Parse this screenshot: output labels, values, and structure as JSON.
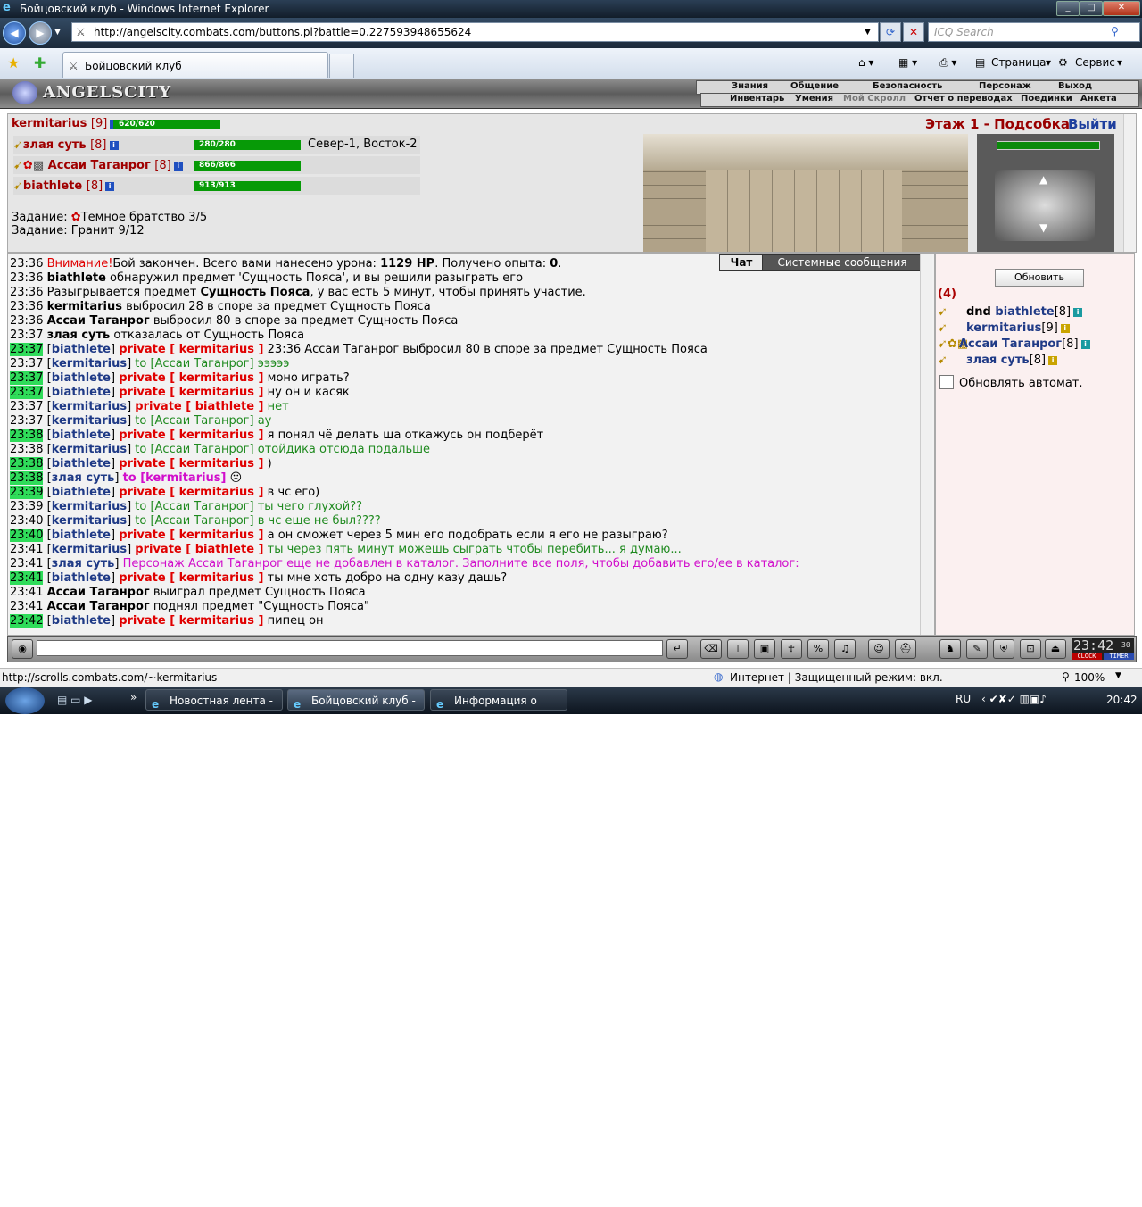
{
  "window": {
    "title": "Бойцовский клуб - Windows Internet Explorer",
    "btn_min": "_",
    "btn_max": "□",
    "btn_close": "✕"
  },
  "browser": {
    "url": "http://angelscity.combats.com/buttons.pl?battle=0.227593948655624",
    "search_placeholder": "ICQ Search",
    "tab_title": "Бойцовский клуб",
    "tool_page": "Страница",
    "tool_service": "Сервис",
    "status_url": "http://scrolls.combats.com/~kermitarius",
    "status_zone": "Интернет | Защищенный режим: вкл.",
    "zoom": "100%"
  },
  "game": {
    "logo": "ANGELSCITY",
    "menu_top": [
      "Знания",
      "Общение",
      "Безопасность",
      "Персонаж",
      "Выход"
    ],
    "menu_bottom": [
      "Инвентарь",
      "Умения",
      "Мой Скролл",
      "Отчет о переводах",
      "Поединки",
      "Анкета"
    ],
    "self": {
      "name": "kermitarius",
      "level": "[9]",
      "hp": "620/620",
      "hp_fraction": 1.0
    },
    "party": [
      {
        "name": "злая суть",
        "level": "[8]",
        "hp": "280/280",
        "hp_fraction": 1.0
      },
      {
        "name": "Ассаи Таганрог",
        "level": "[8]",
        "hp": "866/866",
        "hp_fraction": 1.0
      },
      {
        "name": "biathlete",
        "level": "[8]",
        "hp": "913/913",
        "hp_fraction": 1.0
      }
    ],
    "coords": "Север-1, Восток-2",
    "quest1_label": "Задание:",
    "quest1": "Темное братство 3/5",
    "quest2": "Задание: Гранит 9/12",
    "floor": "Этаж 1 - Подсобка",
    "exit": "Выйти"
  },
  "chat": {
    "tab_chat": "Чат",
    "tab_system": "Системные сообщения",
    "lines": [
      {
        "t": "23:36",
        "parts": [
          [
            "red",
            "Внимание!"
          ],
          [
            "",
            "Бой закончен. Всего вами нанесено урона: "
          ],
          [
            "b",
            "1129 HP"
          ],
          [
            "",
            ". Получено опыта: "
          ],
          [
            "b",
            "0"
          ],
          [
            "",
            "."
          ]
        ]
      },
      {
        "t": "23:36",
        "parts": [
          [
            "b",
            "biathlete"
          ],
          [
            "",
            " обнаружил предмет 'Сущность Пояса', и вы решили разыграть его"
          ]
        ]
      },
      {
        "t": "23:36",
        "parts": [
          [
            "",
            "Разыгрывается предмет "
          ],
          [
            "b",
            "Сущность Пояса"
          ],
          [
            "",
            ", у вас есть 5 минут, чтобы принять участие."
          ]
        ]
      },
      {
        "t": "23:36",
        "parts": [
          [
            "b",
            "kermitarius"
          ],
          [
            "",
            " выбросил 28 в споре за предмет Сущность Пояса"
          ]
        ]
      },
      {
        "t": "23:36",
        "parts": [
          [
            "b",
            "Ассаи Таганрог"
          ],
          [
            "",
            " выбросил 80 в споре за предмет Сущность Пояса"
          ]
        ]
      },
      {
        "t": "23:37",
        "parts": [
          [
            "b",
            "злая суть"
          ],
          [
            "",
            " отказалась от Сущность Пояса"
          ]
        ]
      },
      {
        "t": "23:37",
        "hl": true,
        "parts": [
          [
            "",
            "["
          ],
          [
            "nick",
            "biathlete"
          ],
          [
            "",
            "] "
          ],
          [
            "priv",
            "private [ kermitarius ]"
          ],
          [
            "",
            " 23:36 Ассаи Таганрог выбросил 80 в споре за предмет Сущность Пояса"
          ]
        ]
      },
      {
        "t": "23:37",
        "parts": [
          [
            "",
            "["
          ],
          [
            "nick",
            "kermitarius"
          ],
          [
            "",
            "] "
          ],
          [
            "grn",
            "to [Ассаи Таганрог] эээээ"
          ]
        ]
      },
      {
        "t": "23:37",
        "hl": true,
        "parts": [
          [
            "",
            "["
          ],
          [
            "nick",
            "biathlete"
          ],
          [
            "",
            "] "
          ],
          [
            "priv",
            "private [ kermitarius ]"
          ],
          [
            "",
            " моно играть?"
          ]
        ]
      },
      {
        "t": "23:37",
        "hl": true,
        "parts": [
          [
            "",
            "["
          ],
          [
            "nick",
            "biathlete"
          ],
          [
            "",
            "] "
          ],
          [
            "priv",
            "private [ kermitarius ]"
          ],
          [
            "",
            " ну он и касяк"
          ]
        ]
      },
      {
        "t": "23:37",
        "parts": [
          [
            "",
            "["
          ],
          [
            "nick",
            "kermitarius"
          ],
          [
            "",
            "] "
          ],
          [
            "priv",
            "private [ biathlete ]"
          ],
          [
            "grn",
            " нет"
          ]
        ]
      },
      {
        "t": "23:37",
        "parts": [
          [
            "",
            "["
          ],
          [
            "nick",
            "kermitarius"
          ],
          [
            "",
            "] "
          ],
          [
            "grn",
            "to [Ассаи Таганрог] ау"
          ]
        ]
      },
      {
        "t": "23:38",
        "hl": true,
        "parts": [
          [
            "",
            "["
          ],
          [
            "nick",
            "biathlete"
          ],
          [
            "",
            "] "
          ],
          [
            "priv",
            "private [ kermitarius ]"
          ],
          [
            "",
            " я понял чё делать ща откажусь он подберёт"
          ]
        ]
      },
      {
        "t": "23:38",
        "parts": [
          [
            "",
            "["
          ],
          [
            "nick",
            "kermitarius"
          ],
          [
            "",
            "] "
          ],
          [
            "grn",
            "to [Ассаи Таганрог] отойдика отсюда подальше"
          ]
        ]
      },
      {
        "t": "23:38",
        "hl": true,
        "parts": [
          [
            "",
            "["
          ],
          [
            "nick",
            "biathlete"
          ],
          [
            "",
            "] "
          ],
          [
            "priv",
            "private [ kermitarius ]"
          ],
          [
            "",
            " )"
          ]
        ]
      },
      {
        "t": "23:38",
        "hl": true,
        "parts": [
          [
            "",
            "["
          ],
          [
            "nick",
            "злая суть"
          ],
          [
            "",
            "] "
          ],
          [
            "toP",
            "to [kermitarius]"
          ],
          [
            "",
            " ☹"
          ]
        ]
      },
      {
        "t": "23:39",
        "hl": true,
        "parts": [
          [
            "",
            "["
          ],
          [
            "nick",
            "biathlete"
          ],
          [
            "",
            "] "
          ],
          [
            "priv",
            "private [ kermitarius ]"
          ],
          [
            "",
            " в чс его)"
          ]
        ]
      },
      {
        "t": "23:39",
        "parts": [
          [
            "",
            "["
          ],
          [
            "nick",
            "kermitarius"
          ],
          [
            "",
            "] "
          ],
          [
            "grn",
            "to [Ассаи Таганрог] ты чего глухой??"
          ]
        ]
      },
      {
        "t": "23:40",
        "parts": [
          [
            "",
            "["
          ],
          [
            "nick",
            "kermitarius"
          ],
          [
            "",
            "] "
          ],
          [
            "grn",
            "to [Ассаи Таганрог] в чс еще не был????"
          ]
        ]
      },
      {
        "t": "23:40",
        "hl": true,
        "parts": [
          [
            "",
            "["
          ],
          [
            "nick",
            "biathlete"
          ],
          [
            "",
            "] "
          ],
          [
            "priv",
            "private [ kermitarius ]"
          ],
          [
            "",
            " а он сможет через 5 мин его подобрать если я его не разыграю?"
          ]
        ]
      },
      {
        "t": "23:41",
        "parts": [
          [
            "",
            "["
          ],
          [
            "nick",
            "kermitarius"
          ],
          [
            "",
            "] "
          ],
          [
            "priv",
            "private [ biathlete ]"
          ],
          [
            "grn",
            " ты через пять минут можешь сыграть чтобы перебить... я думаю..."
          ]
        ]
      },
      {
        "t": "23:41",
        "parts": [
          [
            "",
            "["
          ],
          [
            "nick",
            "злая суть"
          ],
          [
            "",
            "] "
          ],
          [
            "mag",
            "Персонаж Ассаи Таганрог еще не добавлен в каталог. Заполните все поля, чтобы добавить его/ее в каталог:"
          ]
        ]
      },
      {
        "t": "23:41",
        "hl": true,
        "parts": [
          [
            "",
            "["
          ],
          [
            "nick",
            "biathlete"
          ],
          [
            "",
            "] "
          ],
          [
            "priv",
            "private [ kermitarius ]"
          ],
          [
            "",
            " ты мне хоть добро на одну казу дашь?"
          ]
        ]
      },
      {
        "t": "23:41",
        "parts": [
          [
            "b",
            "Ассаи Таганрог"
          ],
          [
            "",
            " выиграл предмет Сущность Пояса"
          ]
        ]
      },
      {
        "t": "23:41",
        "parts": [
          [
            "b",
            "Ассаи Таганрог"
          ],
          [
            "",
            " поднял предмет \"Сущность Пояса\""
          ]
        ]
      },
      {
        "t": "23:42",
        "hl": true,
        "parts": [
          [
            "",
            "["
          ],
          [
            "nick",
            "biathlete"
          ],
          [
            "",
            "] "
          ],
          [
            "priv",
            "private [ kermitarius ]"
          ],
          [
            "",
            " пипец он"
          ]
        ]
      }
    ]
  },
  "online": {
    "refresh_btn": "Обновить",
    "count": "(4)",
    "users": [
      {
        "prefix": "dnd ",
        "name": "biathlete",
        "level": "[8]"
      },
      {
        "prefix": "",
        "name": "kermitarius",
        "level": "[9]"
      },
      {
        "prefix": "",
        "name": "Ассаи Таганрог",
        "level": "[8]"
      },
      {
        "prefix": "",
        "name": "злая суть",
        "level": "[8]"
      }
    ],
    "auto_refresh": "Обновлять автомат."
  },
  "toolbar": {
    "clock": "23:42",
    "clock_sec": "30",
    "clock_label": "CLOCK",
    "timer_label": "TIMER"
  },
  "taskbar": {
    "tasks": [
      "Новостная лента - ...",
      "Бойцовский клуб - ...",
      "Информация о Асс..."
    ],
    "lang": "RU",
    "time": "20:42"
  }
}
